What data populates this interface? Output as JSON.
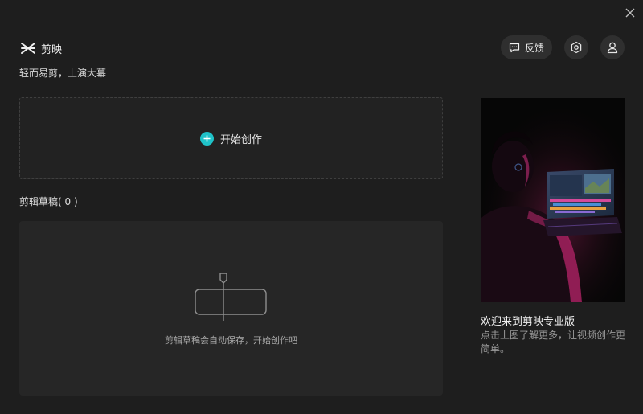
{
  "brand": {
    "name": "剪映",
    "slogan": "轻而易剪，上演大幕",
    "icon": "jianying-logo-icon"
  },
  "header": {
    "feedback_label": "反馈",
    "feedback_icon": "message-icon",
    "settings_icon": "settings-hexagon-icon",
    "user_icon": "user-icon",
    "close_icon": "close-icon"
  },
  "create": {
    "label": "开始创作",
    "icon": "plus-circle-icon",
    "accent_color": "#1fc2c8"
  },
  "drafts": {
    "heading": "剪辑草稿( 0 )",
    "empty_text": "剪辑草稿会自动保存，开始创作吧",
    "empty_icon": "empty-clip-icon"
  },
  "promo": {
    "title": "欢迎来到剪映专业版",
    "description": "点击上图了解更多，让视频创作更简单。",
    "image": "person-editing-on-laptop-image"
  }
}
